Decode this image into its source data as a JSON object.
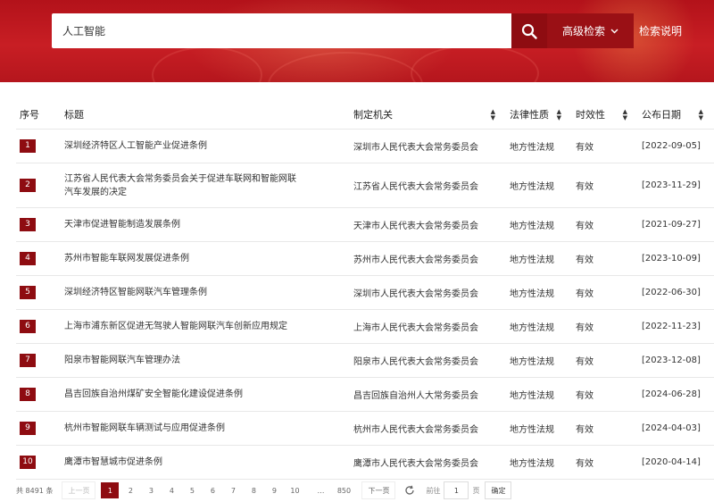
{
  "search": {
    "value": "人工智能",
    "advanced_label": "高级检索",
    "help_label": "检索说明"
  },
  "table": {
    "columns": [
      "序号",
      "标题",
      "制定机关",
      "法律性质",
      "时效性",
      "公布日期"
    ],
    "rows": [
      {
        "no": "1",
        "title": "深圳经济特区人工智能产业促进条例",
        "agency": "深圳市人民代表大会常务委员会",
        "nature": "地方性法规",
        "validity": "有效",
        "date": "[2022-09-05]"
      },
      {
        "no": "2",
        "title": "江苏省人民代表大会常务委员会关于促进车联网和智能网联汽车发展的决定",
        "agency": "江苏省人民代表大会常务委员会",
        "nature": "地方性法规",
        "validity": "有效",
        "date": "[2023-11-29]"
      },
      {
        "no": "3",
        "title": "天津市促进智能制造发展条例",
        "agency": "天津市人民代表大会常务委员会",
        "nature": "地方性法规",
        "validity": "有效",
        "date": "[2021-09-27]"
      },
      {
        "no": "4",
        "title": "苏州市智能车联网发展促进条例",
        "agency": "苏州市人民代表大会常务委员会",
        "nature": "地方性法规",
        "validity": "有效",
        "date": "[2023-10-09]"
      },
      {
        "no": "5",
        "title": "深圳经济特区智能网联汽车管理条例",
        "agency": "深圳市人民代表大会常务委员会",
        "nature": "地方性法规",
        "validity": "有效",
        "date": "[2022-06-30]"
      },
      {
        "no": "6",
        "title": "上海市浦东新区促进无驾驶人智能网联汽车创新应用规定",
        "agency": "上海市人民代表大会常务委员会",
        "nature": "地方性法规",
        "validity": "有效",
        "date": "[2022-11-23]"
      },
      {
        "no": "7",
        "title": "阳泉市智能网联汽车管理办法",
        "agency": "阳泉市人民代表大会常务委员会",
        "nature": "地方性法规",
        "validity": "有效",
        "date": "[2023-12-08]"
      },
      {
        "no": "8",
        "title": "昌吉回族自治州煤矿安全智能化建设促进条例",
        "agency": "昌吉回族自治州人大常务委员会",
        "nature": "地方性法规",
        "validity": "有效",
        "date": "[2024-06-28]"
      },
      {
        "no": "9",
        "title": "杭州市智能网联车辆测试与应用促进条例",
        "agency": "杭州市人民代表大会常务委员会",
        "nature": "地方性法规",
        "validity": "有效",
        "date": "[2024-04-03]"
      },
      {
        "no": "10",
        "title": "鹰潭市智慧城市促进条例",
        "agency": "鹰潭市人民代表大会常务委员会",
        "nature": "地方性法规",
        "validity": "有效",
        "date": "[2020-04-14]"
      }
    ]
  },
  "pager": {
    "total_text": "共 8491 条",
    "prev_label": "上一页",
    "pages": [
      "1",
      "2",
      "3",
      "4",
      "5",
      "6",
      "7",
      "8",
      "9",
      "10",
      "…",
      "850"
    ],
    "active_page": "1",
    "next_label": "下一页",
    "goto_prefix": "前往",
    "goto_value": "1",
    "goto_suffix": "页",
    "confirm_label": "确定"
  },
  "colors": {
    "header_red": "#c81e24",
    "accent_dark_red": "#8e0c11"
  },
  "icons": {
    "search": "search-icon",
    "dropdown": "chevron-down-icon",
    "sort": "sort-icon",
    "refresh": "refresh-icon"
  }
}
